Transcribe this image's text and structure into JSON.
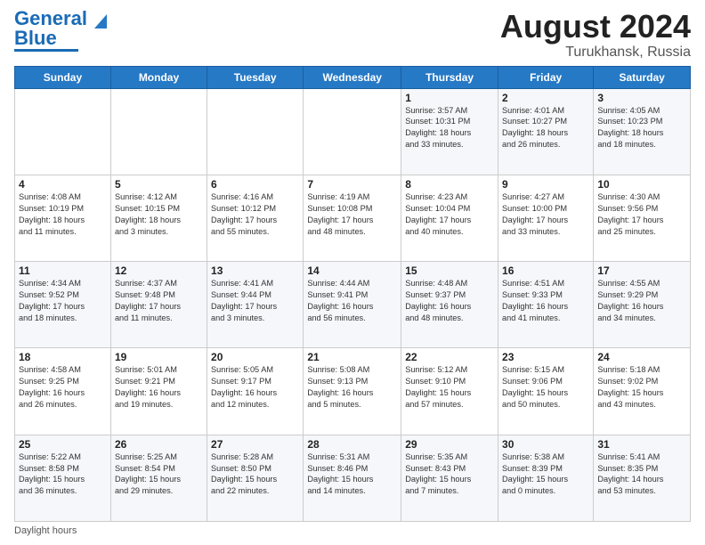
{
  "title": "August 2024",
  "location": "Turukhansk, Russia",
  "logo": {
    "line1": "General",
    "line2": "Blue"
  },
  "days_of_week": [
    "Sunday",
    "Monday",
    "Tuesday",
    "Wednesday",
    "Thursday",
    "Friday",
    "Saturday"
  ],
  "footer": "Daylight hours",
  "weeks": [
    [
      {
        "num": "",
        "info": ""
      },
      {
        "num": "",
        "info": ""
      },
      {
        "num": "",
        "info": ""
      },
      {
        "num": "",
        "info": ""
      },
      {
        "num": "1",
        "info": "Sunrise: 3:57 AM\nSunset: 10:31 PM\nDaylight: 18 hours\nand 33 minutes."
      },
      {
        "num": "2",
        "info": "Sunrise: 4:01 AM\nSunset: 10:27 PM\nDaylight: 18 hours\nand 26 minutes."
      },
      {
        "num": "3",
        "info": "Sunrise: 4:05 AM\nSunset: 10:23 PM\nDaylight: 18 hours\nand 18 minutes."
      }
    ],
    [
      {
        "num": "4",
        "info": "Sunrise: 4:08 AM\nSunset: 10:19 PM\nDaylight: 18 hours\nand 11 minutes."
      },
      {
        "num": "5",
        "info": "Sunrise: 4:12 AM\nSunset: 10:15 PM\nDaylight: 18 hours\nand 3 minutes."
      },
      {
        "num": "6",
        "info": "Sunrise: 4:16 AM\nSunset: 10:12 PM\nDaylight: 17 hours\nand 55 minutes."
      },
      {
        "num": "7",
        "info": "Sunrise: 4:19 AM\nSunset: 10:08 PM\nDaylight: 17 hours\nand 48 minutes."
      },
      {
        "num": "8",
        "info": "Sunrise: 4:23 AM\nSunset: 10:04 PM\nDaylight: 17 hours\nand 40 minutes."
      },
      {
        "num": "9",
        "info": "Sunrise: 4:27 AM\nSunset: 10:00 PM\nDaylight: 17 hours\nand 33 minutes."
      },
      {
        "num": "10",
        "info": "Sunrise: 4:30 AM\nSunset: 9:56 PM\nDaylight: 17 hours\nand 25 minutes."
      }
    ],
    [
      {
        "num": "11",
        "info": "Sunrise: 4:34 AM\nSunset: 9:52 PM\nDaylight: 17 hours\nand 18 minutes."
      },
      {
        "num": "12",
        "info": "Sunrise: 4:37 AM\nSunset: 9:48 PM\nDaylight: 17 hours\nand 11 minutes."
      },
      {
        "num": "13",
        "info": "Sunrise: 4:41 AM\nSunset: 9:44 PM\nDaylight: 17 hours\nand 3 minutes."
      },
      {
        "num": "14",
        "info": "Sunrise: 4:44 AM\nSunset: 9:41 PM\nDaylight: 16 hours\nand 56 minutes."
      },
      {
        "num": "15",
        "info": "Sunrise: 4:48 AM\nSunset: 9:37 PM\nDaylight: 16 hours\nand 48 minutes."
      },
      {
        "num": "16",
        "info": "Sunrise: 4:51 AM\nSunset: 9:33 PM\nDaylight: 16 hours\nand 41 minutes."
      },
      {
        "num": "17",
        "info": "Sunrise: 4:55 AM\nSunset: 9:29 PM\nDaylight: 16 hours\nand 34 minutes."
      }
    ],
    [
      {
        "num": "18",
        "info": "Sunrise: 4:58 AM\nSunset: 9:25 PM\nDaylight: 16 hours\nand 26 minutes."
      },
      {
        "num": "19",
        "info": "Sunrise: 5:01 AM\nSunset: 9:21 PM\nDaylight: 16 hours\nand 19 minutes."
      },
      {
        "num": "20",
        "info": "Sunrise: 5:05 AM\nSunset: 9:17 PM\nDaylight: 16 hours\nand 12 minutes."
      },
      {
        "num": "21",
        "info": "Sunrise: 5:08 AM\nSunset: 9:13 PM\nDaylight: 16 hours\nand 5 minutes."
      },
      {
        "num": "22",
        "info": "Sunrise: 5:12 AM\nSunset: 9:10 PM\nDaylight: 15 hours\nand 57 minutes."
      },
      {
        "num": "23",
        "info": "Sunrise: 5:15 AM\nSunset: 9:06 PM\nDaylight: 15 hours\nand 50 minutes."
      },
      {
        "num": "24",
        "info": "Sunrise: 5:18 AM\nSunset: 9:02 PM\nDaylight: 15 hours\nand 43 minutes."
      }
    ],
    [
      {
        "num": "25",
        "info": "Sunrise: 5:22 AM\nSunset: 8:58 PM\nDaylight: 15 hours\nand 36 minutes."
      },
      {
        "num": "26",
        "info": "Sunrise: 5:25 AM\nSunset: 8:54 PM\nDaylight: 15 hours\nand 29 minutes."
      },
      {
        "num": "27",
        "info": "Sunrise: 5:28 AM\nSunset: 8:50 PM\nDaylight: 15 hours\nand 22 minutes."
      },
      {
        "num": "28",
        "info": "Sunrise: 5:31 AM\nSunset: 8:46 PM\nDaylight: 15 hours\nand 14 minutes."
      },
      {
        "num": "29",
        "info": "Sunrise: 5:35 AM\nSunset: 8:43 PM\nDaylight: 15 hours\nand 7 minutes."
      },
      {
        "num": "30",
        "info": "Sunrise: 5:38 AM\nSunset: 8:39 PM\nDaylight: 15 hours\nand 0 minutes."
      },
      {
        "num": "31",
        "info": "Sunrise: 5:41 AM\nSunset: 8:35 PM\nDaylight: 14 hours\nand 53 minutes."
      }
    ]
  ]
}
